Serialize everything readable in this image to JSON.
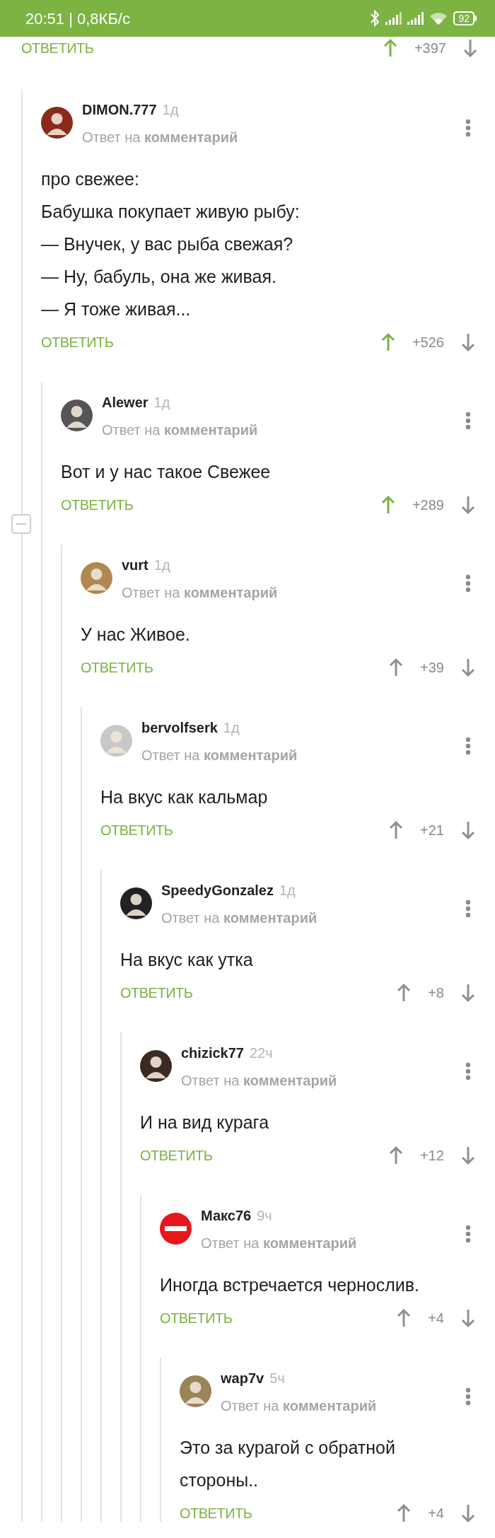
{
  "status_bar": {
    "time": "20:51 | 0,8КБ/с",
    "battery": "92"
  },
  "previous_comment_actions": {
    "reply_label": "ОТВЕТИТЬ",
    "score": "+397",
    "upvoted": true
  },
  "comment": {
    "author": "DIMON.777",
    "time": "1д",
    "reply_to": "Ответ на **комментарий**",
    "avatar": {
      "kind": "photo",
      "color": "#8b2a1a"
    },
    "body": "про свежее:\nБабушка покупает живую рыбу:\n— Внучек, у вас рыба свежая?\n— Ну, бабуль, она же живая.\n— Я тоже живая...",
    "reply_label": "ОТВЕТИТЬ",
    "score": "+526",
    "upvoted": true,
    "collapse_button": true,
    "children": [
      {
        "author": "Alewer",
        "time": "1д",
        "reply_to": "Ответ на **комментарий**",
        "avatar": {
          "kind": "photo",
          "color": "#555555"
        },
        "body": "Вот и у нас такое Свежее",
        "reply_label": "ОТВЕТИТЬ",
        "score": "+289",
        "upvoted": true,
        "children": [
          {
            "author": "vurt",
            "time": "1д",
            "reply_to": "Ответ на **комментарий**",
            "avatar": {
              "kind": "photo",
              "color": "#b08850"
            },
            "body": "У нас Живое.",
            "reply_label": "ОТВЕТИТЬ",
            "score": "+39",
            "upvoted": false,
            "children": [
              {
                "author": "bervolfserk",
                "time": "1д",
                "reply_to": "Ответ на **комментарий**",
                "avatar": {
                  "kind": "photo",
                  "color": "#c8c8c8"
                },
                "body": "На вкус как кальмар",
                "reply_label": "ОТВЕТИТЬ",
                "score": "+21",
                "upvoted": false,
                "children": [
                  {
                    "author": "SpeedyGonzalez",
                    "time": "1д",
                    "reply_to": "Ответ на **комментарий**",
                    "avatar": {
                      "kind": "photo",
                      "color": "#222222"
                    },
                    "body": "На вкус как утка",
                    "reply_label": "ОТВЕТИТЬ",
                    "score": "+8",
                    "upvoted": false,
                    "children": [
                      {
                        "author": "chizick77",
                        "time": "22ч",
                        "reply_to": "Ответ на **комментарий**",
                        "avatar": {
                          "kind": "photo",
                          "color": "#3a2a22"
                        },
                        "body": "И на вид курага",
                        "reply_label": "ОТВЕТИТЬ",
                        "score": "+12",
                        "upvoted": false,
                        "children": [
                          {
                            "author": "Макс76",
                            "time": "9ч",
                            "reply_to": "Ответ на **комментарий**",
                            "avatar": {
                              "kind": "no-entry",
                              "color": "#e8161b"
                            },
                            "body": "Иногда встречается чернослив.",
                            "reply_label": "ОТВЕТИТЬ",
                            "score": "+4",
                            "upvoted": false,
                            "children": [
                              {
                                "author": "wap7v",
                                "time": "5ч",
                                "reply_to": "Ответ на **комментарий**",
                                "avatar": {
                                  "kind": "photo",
                                  "color": "#9a8458"
                                },
                                "body": "Это за курагой с обратной стороны..",
                                "reply_label": "ОТВЕТИТЬ",
                                "score": "+4",
                                "upvoted": false
                              }
                            ]
                          }
                        ]
                      }
                    ]
                  }
                ]
              }
            ]
          }
        ]
      }
    ]
  }
}
